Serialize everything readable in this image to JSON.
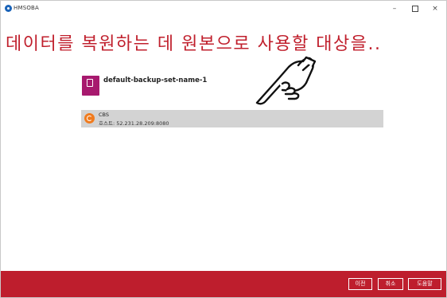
{
  "window": {
    "title": "HMSOBA",
    "min_glyph": "–",
    "close_glyph": "×",
    "app_icon": "app-logo-icon"
  },
  "heading": "데이터를 복원하는 데 원본으로 사용할 대상을..",
  "backup_set": {
    "name": "default-backup-set-name-1",
    "icon": "backup-file-icon",
    "icon_color": "#a7196e"
  },
  "destination": {
    "name": "CBS",
    "host": "호스트: 52.231.28.209:8080",
    "icon": "cbs-icon",
    "icon_color": "#f07b1e"
  },
  "footer": {
    "prev_label": "이전",
    "cancel_label": "취소",
    "help_label": "도움말",
    "background": "#be1e2d"
  },
  "colors": {
    "accent": "#c0202d",
    "row_selected": "#d3d3d3"
  }
}
